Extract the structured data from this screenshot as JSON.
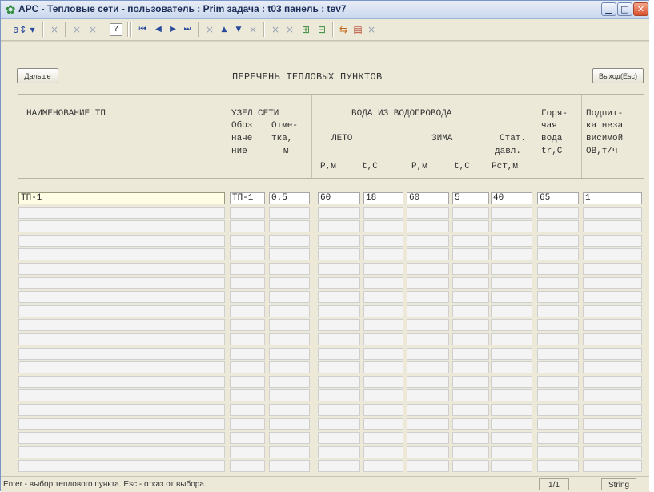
{
  "window": {
    "title": "APC - Тепловые сети -  пользователь : Prim  задача : t03  панель : tev7",
    "accent_color": "#2f8f3a"
  },
  "toolbar": {
    "sort_label": "a↕ ▾",
    "help_label": "?"
  },
  "buttons": {
    "next_label": "Дальше",
    "exit_label": "Выход(Esc)"
  },
  "page_title": "ПЕРЕЧЕНЬ ТЕПЛОВЫХ ПУНКТОВ",
  "table": {
    "headers": {
      "name": "НАИМЕНОВАНИЕ ТП",
      "node_group": "УЗЕЛ СЕТИ",
      "node_desig": [
        "Обоз",
        "наче",
        "ние"
      ],
      "node_elev": [
        "Отме-",
        "тка,",
        "м"
      ],
      "water_group": "ВОДА ИЗ ВОДОПРОВОДА",
      "summer": "ЛЕТО",
      "winter": "ЗИМА",
      "p_summer": "P,м",
      "t_summer": "t,C",
      "p_winter": "P,м",
      "t_winter": "t,C",
      "static": [
        "Стат.",
        "давл.",
        "Рст,м"
      ],
      "hot": [
        "Горя-",
        "чая",
        "вода",
        "tr,C"
      ],
      "makeup": [
        "Подпит-",
        "ка неза",
        "висимой",
        "ОВ,т/ч"
      ]
    },
    "row": {
      "name": "ТП-1",
      "node": "ТП-1",
      "elevation": "0.5",
      "p_summer": "60",
      "t_summer": "18",
      "p_winter": "60",
      "t_winter": "5",
      "static_pressure": "40",
      "hot_water_temp": "65",
      "makeup": "1"
    },
    "empty_rows": 19
  },
  "status": {
    "hint": "Enter - выбор теплового пункта.  Esc - отказ от выбора.",
    "page": "1/1",
    "type": "String"
  }
}
